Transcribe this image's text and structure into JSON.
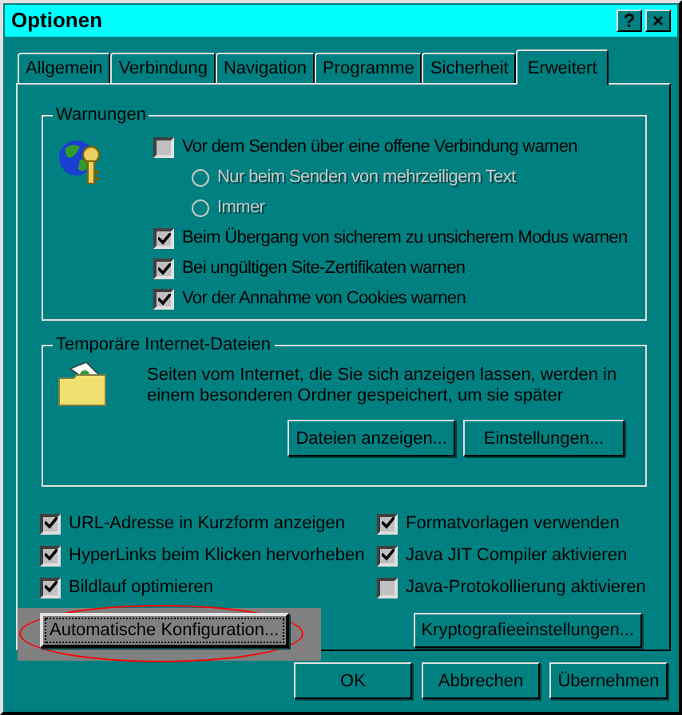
{
  "window": {
    "title": "Optionen",
    "buttons": [
      "?",
      "×"
    ]
  },
  "tabs": [
    {
      "label": "Allgemein",
      "selected": false
    },
    {
      "label": "Verbindung",
      "selected": false
    },
    {
      "label": "Navigation",
      "selected": false
    },
    {
      "label": "Programme",
      "selected": false
    },
    {
      "label": "Sicherheit",
      "selected": false
    },
    {
      "label": "Erweitert",
      "selected": true
    }
  ],
  "warnings": {
    "title": "Warnungen",
    "options": [
      {
        "kind": "checkbox",
        "label": "Vor dem Senden über eine offene Verbindung warnen",
        "checked": false,
        "disabled": false
      },
      {
        "kind": "radio",
        "label": "Nur beim Senden von mehrzeiligem Text",
        "selected": false,
        "disabled": true
      },
      {
        "kind": "radio",
        "label": "Immer",
        "selected": false,
        "disabled": true
      },
      {
        "kind": "checkbox",
        "label": "Beim Übergang von sicherem zu unsicherem Modus warnen",
        "checked": true,
        "disabled": false
      },
      {
        "kind": "checkbox",
        "label": "Bei ungültigen Site-Zertifikaten warnen",
        "checked": true,
        "disabled": false
      },
      {
        "kind": "checkbox",
        "label": "Vor der Annahme von Cookies warnen",
        "checked": true,
        "disabled": false
      }
    ]
  },
  "temp_files": {
    "title": "Temporäre Internet-Dateien",
    "text": "Seiten vom Internet, die Sie sich anzeigen lassen, werden in einem besonderen Ordner gespeichert, um sie später",
    "buttons": [
      "Dateien anzeigen...",
      "Einstellungen..."
    ]
  },
  "options": [
    {
      "label": "URL-Adresse in Kurzform anzeigen",
      "checked": true
    },
    {
      "label": "Formatvorlagen verwenden",
      "checked": true
    },
    {
      "label": "HyperLinks beim Klicken hervorheben",
      "checked": true
    },
    {
      "label": "Java JIT Compiler aktivieren",
      "checked": true
    },
    {
      "label": "Bildlauf optimieren",
      "checked": true
    },
    {
      "label": "Java-Protokollierung aktivieren",
      "checked": false
    }
  ],
  "action_buttons": [
    {
      "label": "Automatische Konfiguration...",
      "highlighted": true
    },
    {
      "label": "Kryptografieeinstellungen...",
      "highlighted": false
    }
  ],
  "footer_buttons": [
    "OK",
    "Abbrechen",
    "Übernehmen"
  ]
}
